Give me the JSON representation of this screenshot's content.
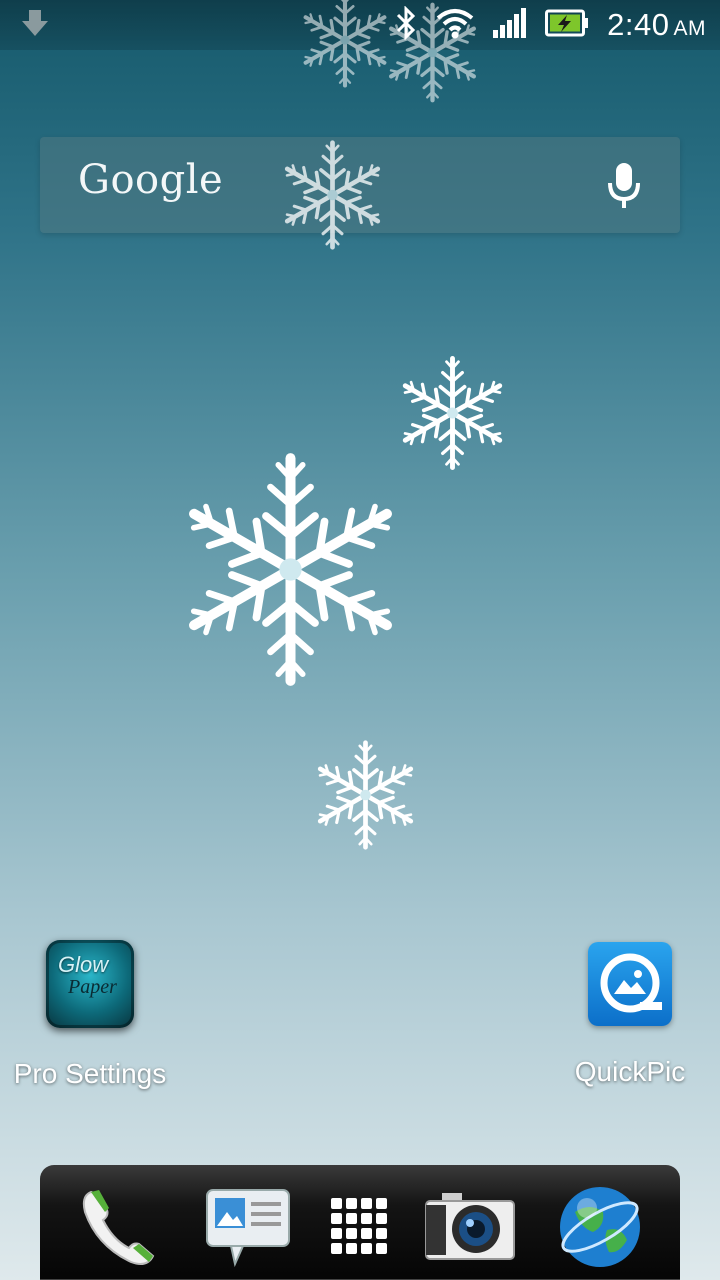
{
  "status_bar": {
    "time": "2:40",
    "ampm": "AM",
    "icons": [
      "download-arrow-icon",
      "bluetooth-icon",
      "wifi-icon",
      "signal-icon",
      "battery-charging-icon"
    ]
  },
  "search_widget": {
    "logo_text": "Google",
    "mic_icon": "mic-icon"
  },
  "home_apps": [
    {
      "label": "Pro Settings",
      "icon": "glow-paper-icon",
      "icon_text_1": "Glow",
      "icon_text_2": "Paper"
    },
    {
      "label": "QuickPic",
      "icon": "quickpic-icon"
    }
  ],
  "dock": {
    "items": [
      "phone-icon",
      "messages-icon",
      "app-drawer-icon",
      "camera-icon",
      "browser-globe-icon"
    ]
  },
  "colors": {
    "wallpaper_top": "#15596b",
    "wallpaper_bottom": "#dfe9ec",
    "dock": "#141414",
    "quickpic_blue": "#1a8ae0"
  }
}
